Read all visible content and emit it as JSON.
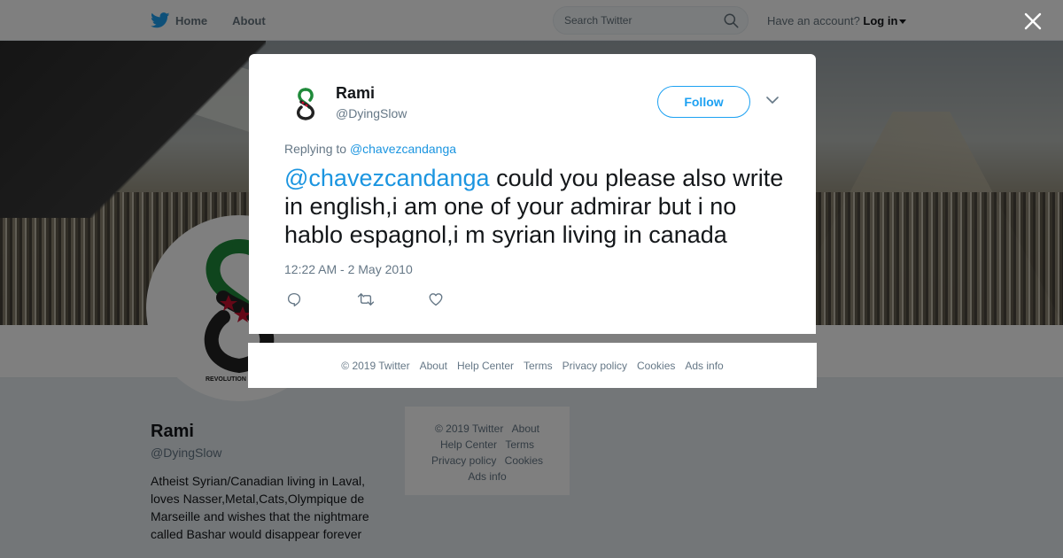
{
  "nav": {
    "home_label": "Home",
    "about_label": "About",
    "search_placeholder": "Search Twitter",
    "account_prompt": "Have an account?",
    "login_label": "Log in"
  },
  "profile": {
    "name": "Rami",
    "handle": "@DyingSlow",
    "bio": "Atheist Syrian/Canadian living in Laval, loves Nasser,Metal,Cats,Olympique de Marseille and wishes that the nightmare called Bashar would disappear forever",
    "avatar_caption": "REVOLUTION UNTIL VICTORY"
  },
  "side_footer": {
    "copyright": "© 2019 Twitter",
    "about": "About",
    "help": "Help Center",
    "terms": "Terms",
    "privacy": "Privacy policy",
    "cookies": "Cookies",
    "ads": "Ads info"
  },
  "tweet": {
    "name": "Rami",
    "handle": "@DyingSlow",
    "follow_label": "Follow",
    "replying_prefix": "Replying to",
    "replying_to": "@chavezcandanga",
    "mention": "@chavezcandanga",
    "text": " could you please also write in english,i am one of your admirar but i no hablo espagnol,i m syrian living in canada",
    "timestamp": "12:22 AM - 2 May 2010"
  },
  "modal_footer": {
    "copyright": "© 2019 Twitter",
    "about": "About",
    "help": "Help Center",
    "terms": "Terms",
    "privacy": "Privacy policy",
    "cookies": "Cookies",
    "ads": "Ads info"
  },
  "icons": {
    "brand": "twitter-bird-icon",
    "search": "search-icon",
    "close": "close-icon",
    "more": "chevron-down-icon",
    "reply": "reply-icon",
    "retweet": "retweet-icon",
    "like": "heart-icon"
  },
  "colors": {
    "accent": "#1da1f2",
    "link": "#1b95e0",
    "muted": "#657786",
    "logo_green": "#1f8a3a",
    "logo_red": "#c8102e"
  }
}
